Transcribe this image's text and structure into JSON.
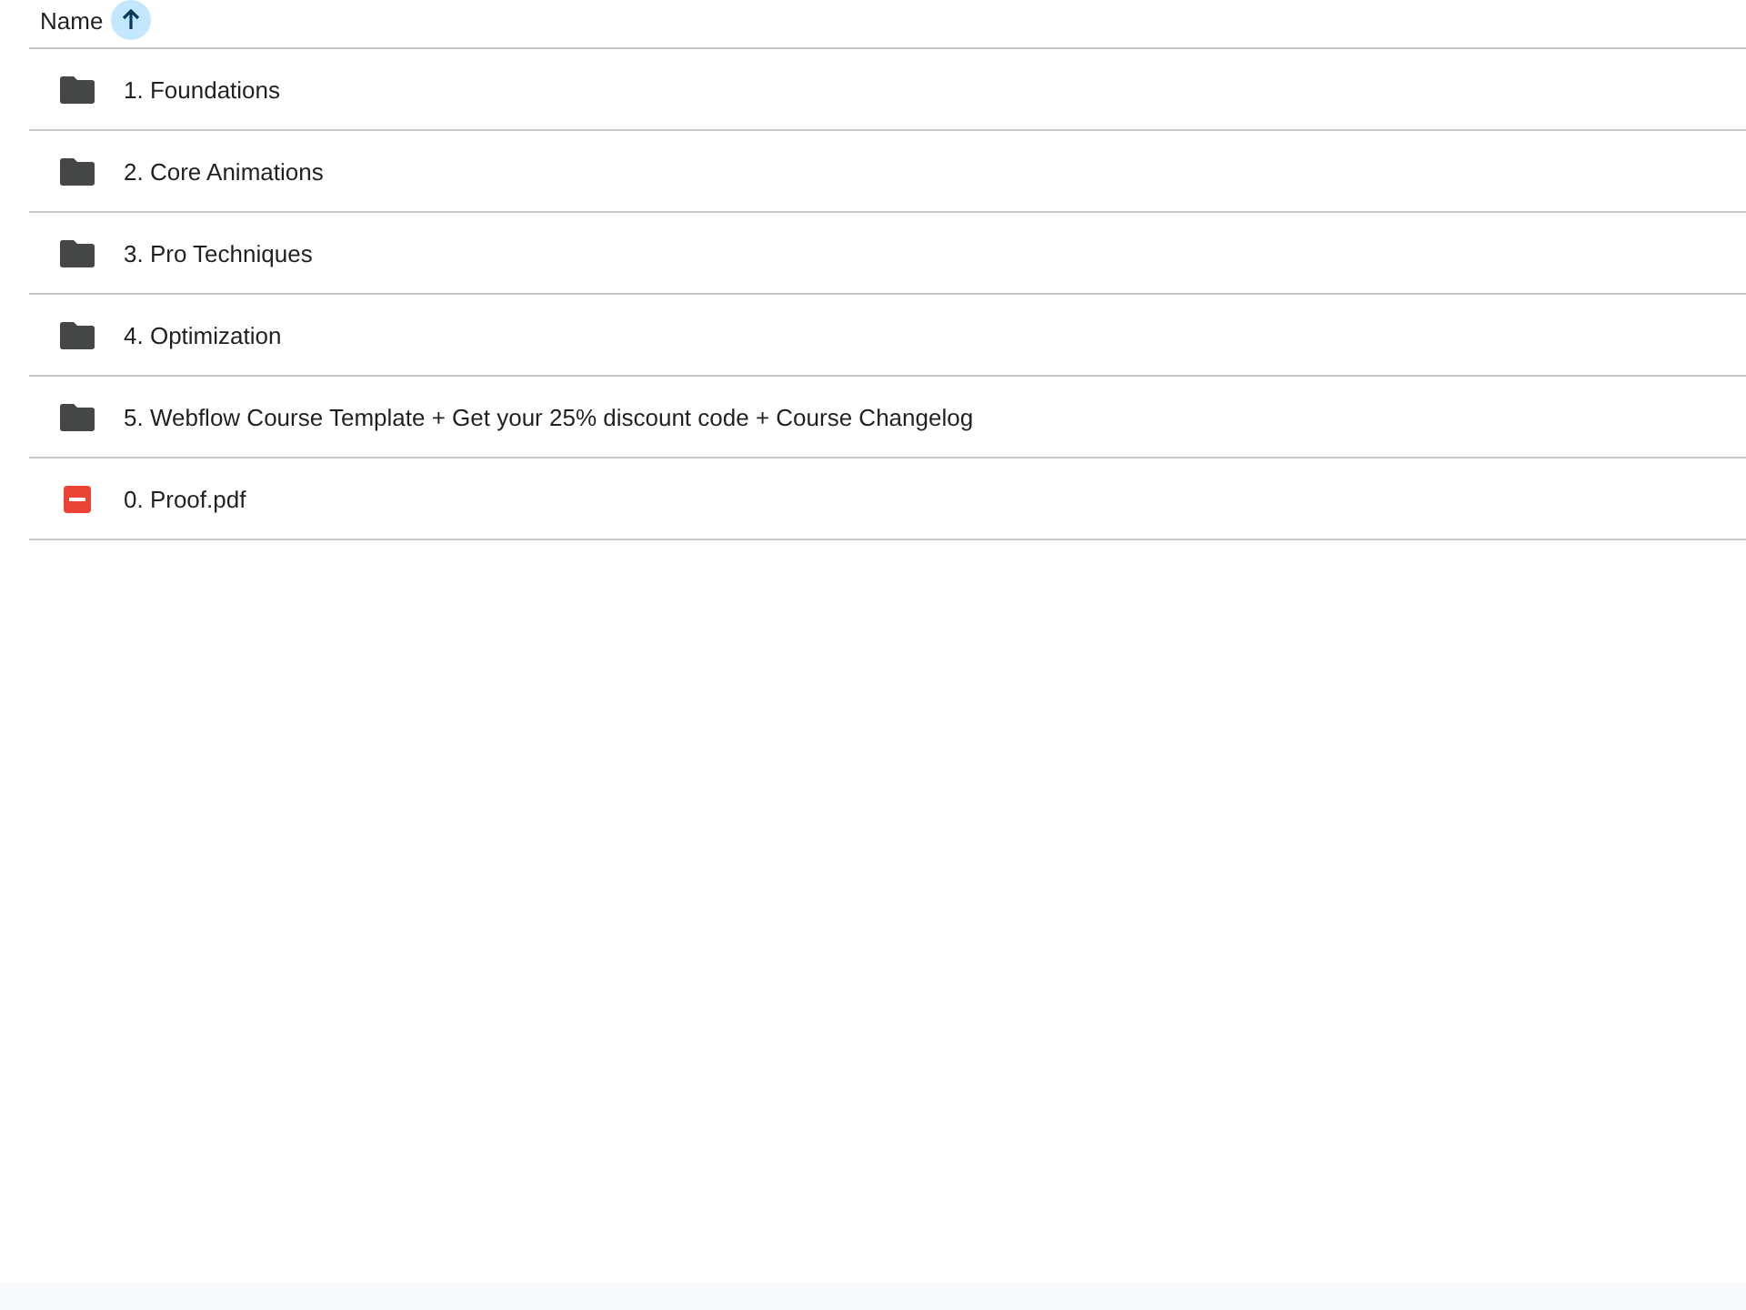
{
  "header": {
    "label": "Name",
    "sort_ascending": true
  },
  "items": [
    {
      "kind": "folder",
      "name": "1. Foundations"
    },
    {
      "kind": "folder",
      "name": "2. Core Animations"
    },
    {
      "kind": "folder",
      "name": "3. Pro Techniques"
    },
    {
      "kind": "folder",
      "name": "4. Optimization"
    },
    {
      "kind": "folder",
      "name": "5. Webflow Course Template + Get your 25% discount code + Course Changelog"
    },
    {
      "kind": "pdf",
      "name": "0. Proof.pdf"
    }
  ]
}
